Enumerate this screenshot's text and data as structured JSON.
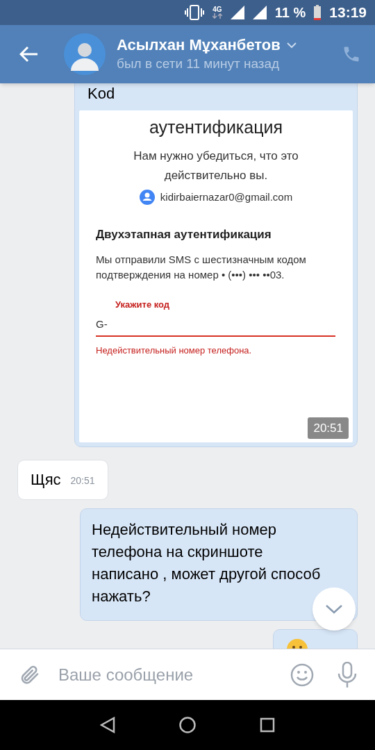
{
  "status_bar": {
    "network": "4G",
    "battery": "11 %",
    "time": "13:19"
  },
  "header": {
    "name": "Асылхан Мұханбетов",
    "status": "был в сети 11 минут назад"
  },
  "messages": [
    {
      "kind": "screenshot",
      "outgoing": true,
      "text": "Kod",
      "time": "20:51",
      "screenshot": {
        "title": "аутентификация",
        "subtitle": "Нам нужно убедиться, что это действительно вы.",
        "email": "kidirbaiernazar0@gmail.com",
        "heading": "Двухэтапная аутентификация",
        "body": "Мы отправили SMS с шестизначным кодом подтверждения на номер • (•••) ••• ••03.",
        "field_label": "Укажите код",
        "field_value": "G-",
        "error": "Недействительный номер телефона."
      }
    },
    {
      "kind": "text",
      "outgoing": false,
      "text": "Щяс",
      "time": "20:51"
    },
    {
      "kind": "text",
      "outgoing": true,
      "text": "Недействительный номер телефона на скриншоте написано , может другой способ нажать?"
    },
    {
      "kind": "emoji",
      "outgoing": true
    }
  ],
  "composer": {
    "placeholder": "Ваше сообщение"
  }
}
